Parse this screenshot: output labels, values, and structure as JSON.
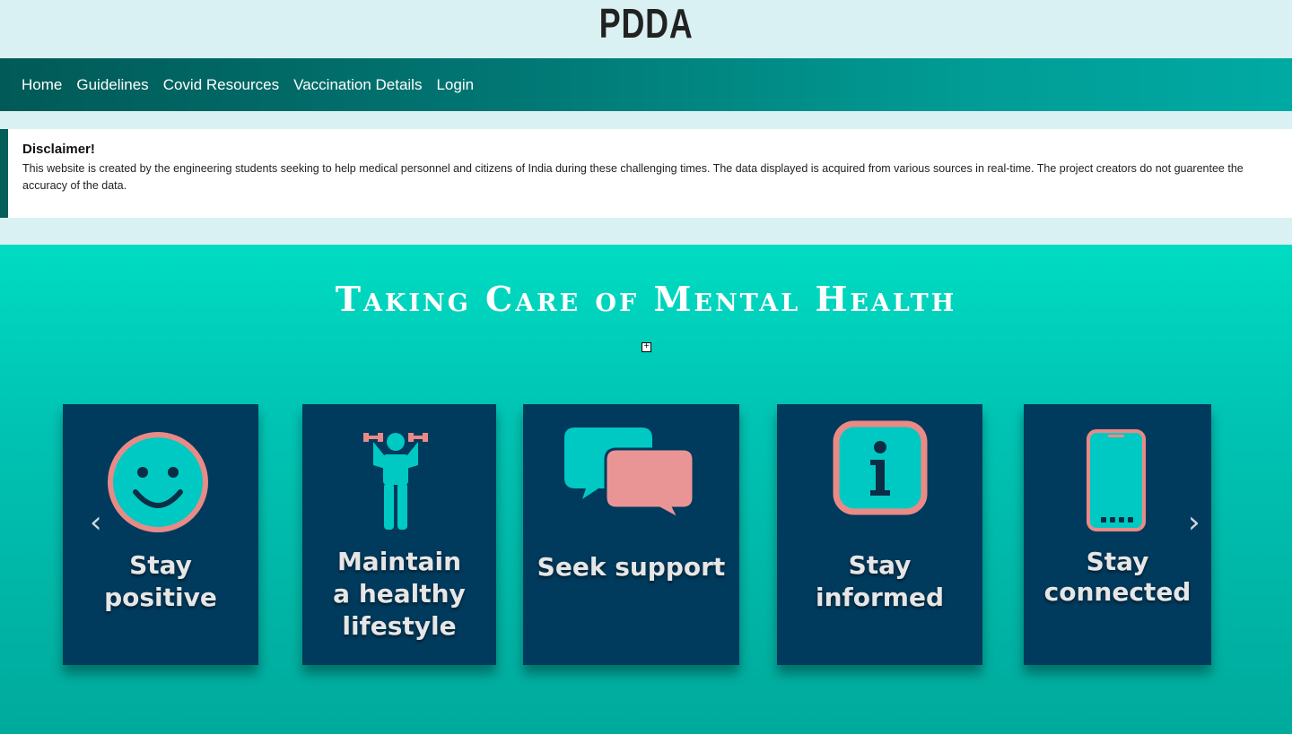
{
  "header": {
    "logo": "PDDA"
  },
  "nav": {
    "items": [
      {
        "label": "Home"
      },
      {
        "label": "Guidelines"
      },
      {
        "label": "Covid Resources"
      },
      {
        "label": "Vaccination Details"
      },
      {
        "label": "Login"
      }
    ]
  },
  "disclaimer": {
    "title": "Disclaimer!",
    "text": "This website is created by the engineering students seeking to help medical personnel and citizens of India during these challenging times. The data displayed is acquired from various sources in real-time. The project creators do not guarentee the accuracy of the data."
  },
  "hero": {
    "title": "Taking Care of Mental Health",
    "cards": [
      {
        "line1": "Stay",
        "line2": "positive",
        "line3": "",
        "icon": "smiley-icon"
      },
      {
        "line1": "Maintain",
        "line2": "a healthy",
        "line3": "lifestyle",
        "icon": "exercise-person-icon"
      },
      {
        "line1": "Seek support",
        "line2": "",
        "line3": "",
        "icon": "chat-bubbles-icon"
      },
      {
        "line1": "Stay",
        "line2": "informed",
        "line3": "",
        "icon": "info-icon"
      },
      {
        "line1": "Stay",
        "line2": "connected",
        "line3": "",
        "icon": "smartphone-icon"
      }
    ],
    "prev_arrow": "‹",
    "next_arrow": "›"
  },
  "colors": {
    "card_bg": "#003a5c",
    "accent_teal": "#00c9c3",
    "accent_pink": "#ea9595",
    "nav_dark": "#015a57"
  }
}
